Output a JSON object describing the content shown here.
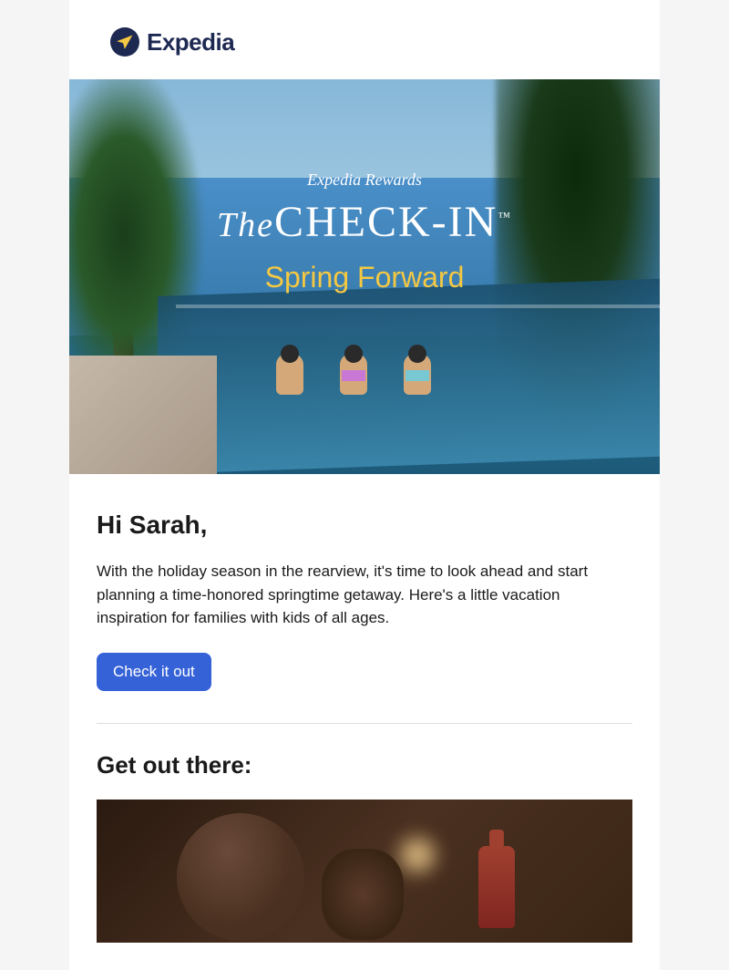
{
  "brand": {
    "name": "Expedia"
  },
  "hero": {
    "rewards_label": "Expedia Rewards",
    "title_the": "The",
    "title_main": "CHECK-IN",
    "title_trademark": "™",
    "subtitle": "Spring Forward"
  },
  "content": {
    "greeting": "Hi Sarah,",
    "intro": "With the holiday season in the rearview, it's time to look ahead and start planning a time-honored springtime getaway. Here's a little vacation inspiration for families with kids of all ages.",
    "cta_label": "Check it out"
  },
  "section": {
    "title": "Get out there:"
  }
}
